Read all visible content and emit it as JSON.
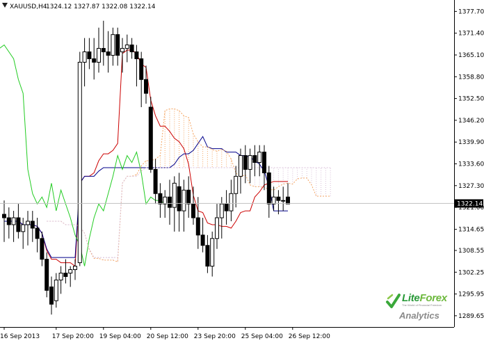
{
  "header": {
    "symbol": "XAUUSD,H4",
    "quote": "1324.12 1327.87 1322.08 1322.14"
  },
  "chart_data": {
    "type": "candlestick",
    "symbol": "XAUUSD,H4",
    "ylim": [
      1286.4,
      1381.0
    ],
    "y_ticks": [
      "1377.70",
      "1371.40",
      "1365.10",
      "1358.80",
      "1352.50",
      "1346.20",
      "1339.90",
      "1333.60",
      "1327.30",
      "1321.00",
      "1314.65",
      "1308.55",
      "1302.25",
      "1295.95",
      "1289.65"
    ],
    "x_ticks": [
      "16 Sep 2013",
      "17 Sep 20:00",
      "19 Sep 04:00",
      "20 Sep 12:00",
      "23 Sep 20:00",
      "25 Sep 04:00",
      "26 Sep 12:00"
    ],
    "current_price": "1322.14",
    "candles": [
      [
        1319,
        1323,
        1311,
        1318
      ],
      [
        1318,
        1321,
        1312,
        1316
      ],
      [
        1316,
        1320,
        1311,
        1318
      ],
      [
        1318,
        1322,
        1312,
        1314
      ],
      [
        1314,
        1318,
        1309,
        1316
      ],
      [
        1316,
        1320,
        1310,
        1317
      ],
      [
        1317,
        1320,
        1311,
        1315
      ],
      [
        1315,
        1318,
        1308,
        1312
      ],
      [
        1312,
        1314,
        1304,
        1306
      ],
      [
        1306,
        1308,
        1295,
        1297
      ],
      [
        1298,
        1301,
        1290,
        1293
      ],
      [
        1294,
        1302,
        1292,
        1300
      ],
      [
        1300,
        1304,
        1296,
        1302
      ],
      [
        1302,
        1306,
        1299,
        1301
      ],
      [
        1302,
        1304,
        1298,
        1303
      ],
      [
        1303,
        1306,
        1300,
        1304
      ],
      [
        1305,
        1366,
        1304,
        1363
      ],
      [
        1363,
        1370,
        1356,
        1366
      ],
      [
        1366,
        1370,
        1361,
        1364
      ],
      [
        1364,
        1370,
        1358,
        1363
      ],
      [
        1363,
        1373,
        1360,
        1367
      ],
      [
        1367,
        1375,
        1362,
        1366
      ],
      [
        1366,
        1372,
        1360,
        1365
      ],
      [
        1365,
        1373,
        1362,
        1371
      ],
      [
        1371,
        1373,
        1362,
        1365
      ],
      [
        1366,
        1370,
        1360,
        1367
      ],
      [
        1367,
        1371,
        1363,
        1368
      ],
      [
        1368,
        1370,
        1364,
        1366
      ],
      [
        1366,
        1368,
        1356,
        1364
      ],
      [
        1364,
        1366,
        1350,
        1358
      ],
      [
        1358,
        1362,
        1351,
        1354
      ],
      [
        1350,
        1353,
        1331,
        1332
      ],
      [
        1332,
        1335,
        1322,
        1325
      ],
      [
        1325,
        1328,
        1318,
        1322
      ],
      [
        1322,
        1326,
        1318,
        1324
      ],
      [
        1324,
        1329,
        1316,
        1321
      ],
      [
        1321,
        1330,
        1314,
        1328
      ],
      [
        1327,
        1331,
        1314,
        1320
      ],
      [
        1320,
        1329,
        1314,
        1326
      ],
      [
        1326,
        1330,
        1318,
        1322
      ],
      [
        1322,
        1327,
        1316,
        1318
      ],
      [
        1318,
        1324,
        1309,
        1313
      ],
      [
        1313,
        1318,
        1308,
        1310
      ],
      [
        1310,
        1313,
        1302,
        1304
      ],
      [
        1304,
        1314,
        1301,
        1312
      ],
      [
        1312,
        1322,
        1309,
        1318
      ],
      [
        1318,
        1324,
        1312,
        1322
      ],
      [
        1322,
        1326,
        1316,
        1320
      ],
      [
        1320,
        1329,
        1317,
        1325
      ],
      [
        1325,
        1333,
        1321,
        1330
      ],
      [
        1330,
        1338,
        1325,
        1336
      ],
      [
        1336,
        1339,
        1328,
        1332
      ],
      [
        1332,
        1338,
        1328,
        1336
      ],
      [
        1336,
        1339,
        1330,
        1334
      ],
      [
        1334,
        1339,
        1330,
        1337
      ],
      [
        1337,
        1339,
        1326,
        1331
      ],
      [
        1331,
        1333,
        1318,
        1322
      ],
      [
        1322,
        1327,
        1320,
        1324
      ],
      [
        1324,
        1326,
        1319,
        1323
      ],
      [
        1323,
        1327,
        1320,
        1323
      ],
      [
        1324,
        1328,
        1322,
        1322
      ]
    ]
  },
  "logo": {
    "brand_part1": "Lite",
    "brand_part2": "Forex",
    "tagline": "The World of Financial Freedom",
    "product": "Analytics"
  }
}
